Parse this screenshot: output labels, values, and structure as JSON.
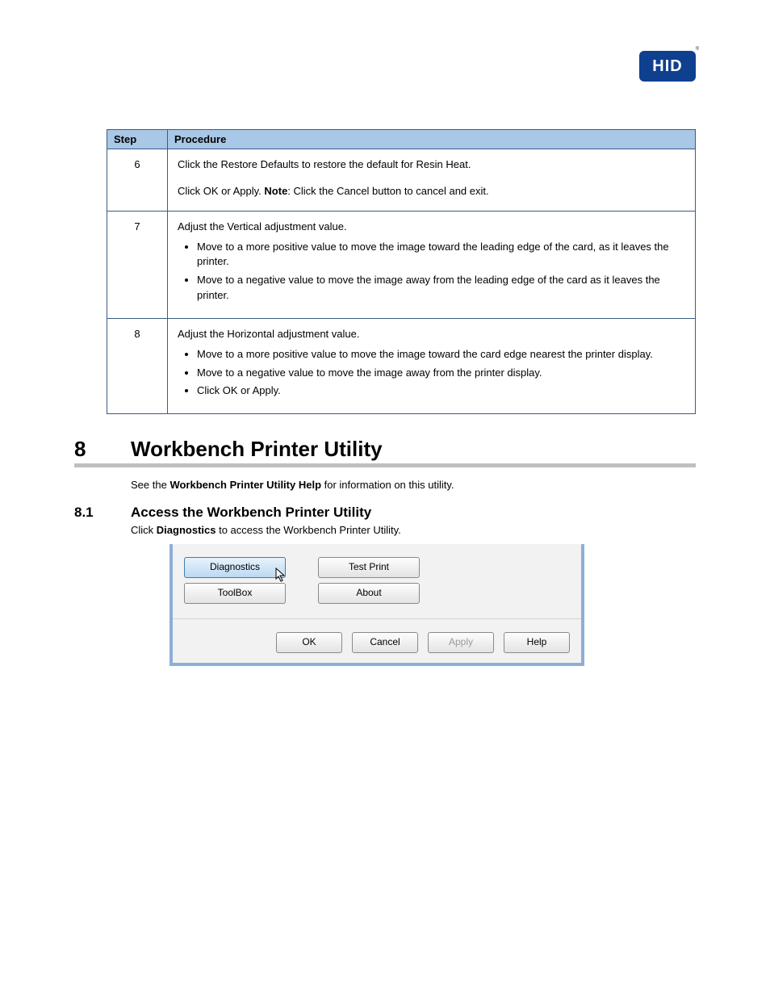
{
  "logo_text": "HID",
  "table": {
    "headers": {
      "step": "Step",
      "procedure": "Procedure"
    },
    "rows": [
      {
        "step": "6",
        "line1": "Click the Restore Defaults to restore the default for Resin Heat.",
        "line2_prefix": "Click OK or Apply. ",
        "note_label": "Note",
        "line2_suffix": ": Click the Cancel button to cancel and exit."
      },
      {
        "step": "7",
        "intro": "Adjust the Vertical adjustment value.",
        "bullet1": "Move to a more positive value to move the image toward the leading edge of the card, as it leaves the printer.",
        "bullet2": "Move to a negative value to move the image away from the leading edge of the card as it leaves the printer."
      },
      {
        "step": "8",
        "intro": "Adjust the Horizontal adjustment value.",
        "bullet1": "Move to a more positive value to move the image toward the card edge nearest the printer display.",
        "bullet2": "Move to a negative value to move the image away from the printer display.",
        "bullet3": "Click OK or Apply."
      }
    ]
  },
  "section": {
    "num": "8",
    "title": "Workbench Printer Utility",
    "text_before": "See the ",
    "text_bold": "Workbench Printer Utility Help",
    "text_after": " for information on this utility."
  },
  "subsection": {
    "num": "8.1",
    "title": "Access the Workbench Printer Utility",
    "desc_before": "Click ",
    "desc_bold": "Diagnostics",
    "desc_after": " to access the Workbench Printer Utility."
  },
  "dialog": {
    "buttons": {
      "diagnostics": "Diagnostics",
      "test_print": "Test Print",
      "toolbox": "ToolBox",
      "about": "About"
    },
    "footer": {
      "ok": "OK",
      "cancel": "Cancel",
      "apply": "Apply",
      "help": "Help"
    }
  }
}
